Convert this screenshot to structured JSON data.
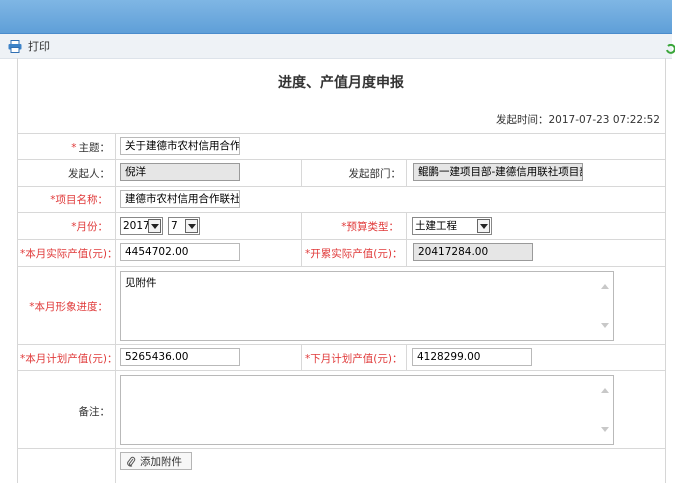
{
  "toolbar": {
    "print_label": "打印"
  },
  "form": {
    "title": "进度、产值月度申报",
    "time_label": "发起时间：",
    "time_value": "2017-07-23 07:22:52",
    "subject": {
      "label": "主题：",
      "value": "关于建德市农村信用合作联"
    },
    "initiator": {
      "label": "发起人：",
      "value": "倪洋"
    },
    "department": {
      "label": "发起部门：",
      "value": "鲲鹏一建项目部-建德信用联社项目部"
    },
    "project": {
      "label": "*项目名称：",
      "value": "建德市农村信用合作联社新"
    },
    "month": {
      "label": "*月份：",
      "year": "2017",
      "month": "7"
    },
    "budget_type": {
      "label": "*预算类型：",
      "value": "土建工程"
    },
    "actual_output": {
      "label": "*本月实际产值(元)：",
      "value": "4454702.00"
    },
    "cumulative_output": {
      "label": "*开累实际产值(元)：",
      "value": "20417284.00"
    },
    "progress": {
      "label": "*本月形象进度：",
      "value": "见附件"
    },
    "plan_this_month": {
      "label": "*本月计划产值(元)：",
      "value": "5265436.00"
    },
    "plan_next_month": {
      "label": "*下月计划产值(元)：",
      "value": "4128299.00"
    },
    "remarks": {
      "label": "备注：",
      "value": ""
    },
    "attach_label": "添加附件"
  },
  "colors": {
    "header_blue": "#6aa8dd",
    "required_red": "#e03a3a"
  }
}
